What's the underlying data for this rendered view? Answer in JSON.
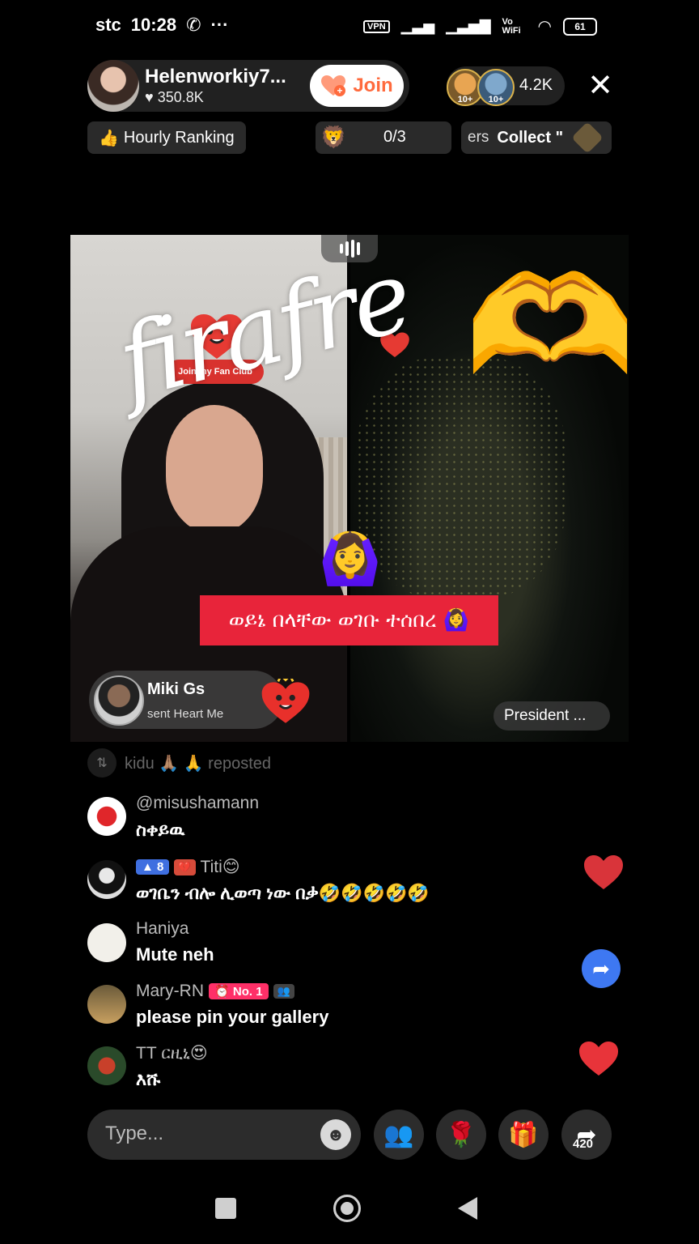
{
  "status_bar": {
    "carrier": "stc",
    "time": "10:28",
    "extra": "···",
    "vpn": "VPN",
    "wifi_label": "Vo WiFi",
    "battery": "61"
  },
  "host": {
    "name": "Helenworkiy7...",
    "likes": "350.8K",
    "join_label": "Join"
  },
  "viewers": {
    "badge1": "10+",
    "badge2": "10+",
    "count": "4.2K"
  },
  "row2": {
    "ranking_label": "Hourly Ranking",
    "task_count": "0/3",
    "collect_prefix": "ers",
    "collect_label": "Collect \""
  },
  "video": {
    "fan_club_label": "Join my Fan Club",
    "overlay_text": "firafre",
    "banner_text": "ወይኔ በላቸው ወገቡ ተሰበረ 🙆‍♀️",
    "right_guest": "President ..."
  },
  "gift": {
    "sender": "Miki Gs",
    "text": "sent Heart Me"
  },
  "comments": {
    "repost": "kidu 🙏🏽 🙏 reposted",
    "items": [
      {
        "name": "@misushamann",
        "text": "ስቀይዉ"
      },
      {
        "level": "8",
        "name": "Titi😊",
        "text": "ወገቤን ብሎ ሊወጣ ነው በቃ🤣🤣🤣🤣🤣"
      },
      {
        "name": "Haniya",
        "text": "Mute neh"
      },
      {
        "name": "Mary-RN",
        "rank": "No. 1",
        "text": "please pin your gallery"
      },
      {
        "name": "TT ርዚኒ😍",
        "text": "እሹ"
      }
    ]
  },
  "bottom": {
    "placeholder": "Type...",
    "share_count": "420"
  }
}
